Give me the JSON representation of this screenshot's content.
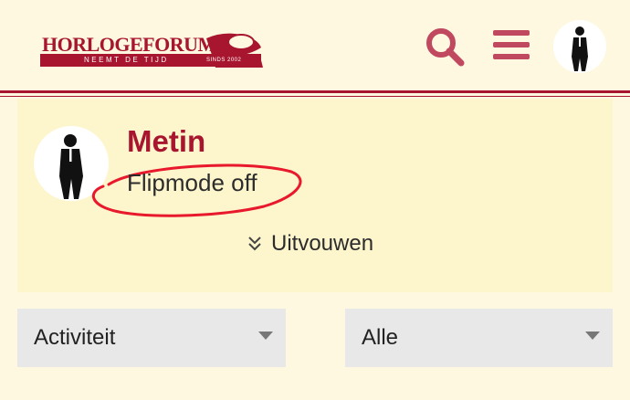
{
  "header": {
    "logo_text": "HORLOGEFORUM.NL",
    "logo_tagline": "NEEMT DE TIJD",
    "logo_since": "SINDS 2002",
    "icons": [
      "search-icon",
      "menu-icon"
    ],
    "accent_color": "#a8152f"
  },
  "profile": {
    "username": "Metin",
    "user_title": "Flipmode off",
    "expand_label": "Uitvouwen"
  },
  "filters": {
    "type_selected": "Activiteit",
    "scope_selected": "Alle"
  },
  "colors": {
    "background": "#fdf8df",
    "card": "#fdf5cc",
    "select": "#e8e8e8",
    "annotation_circle": "#e8192c"
  }
}
